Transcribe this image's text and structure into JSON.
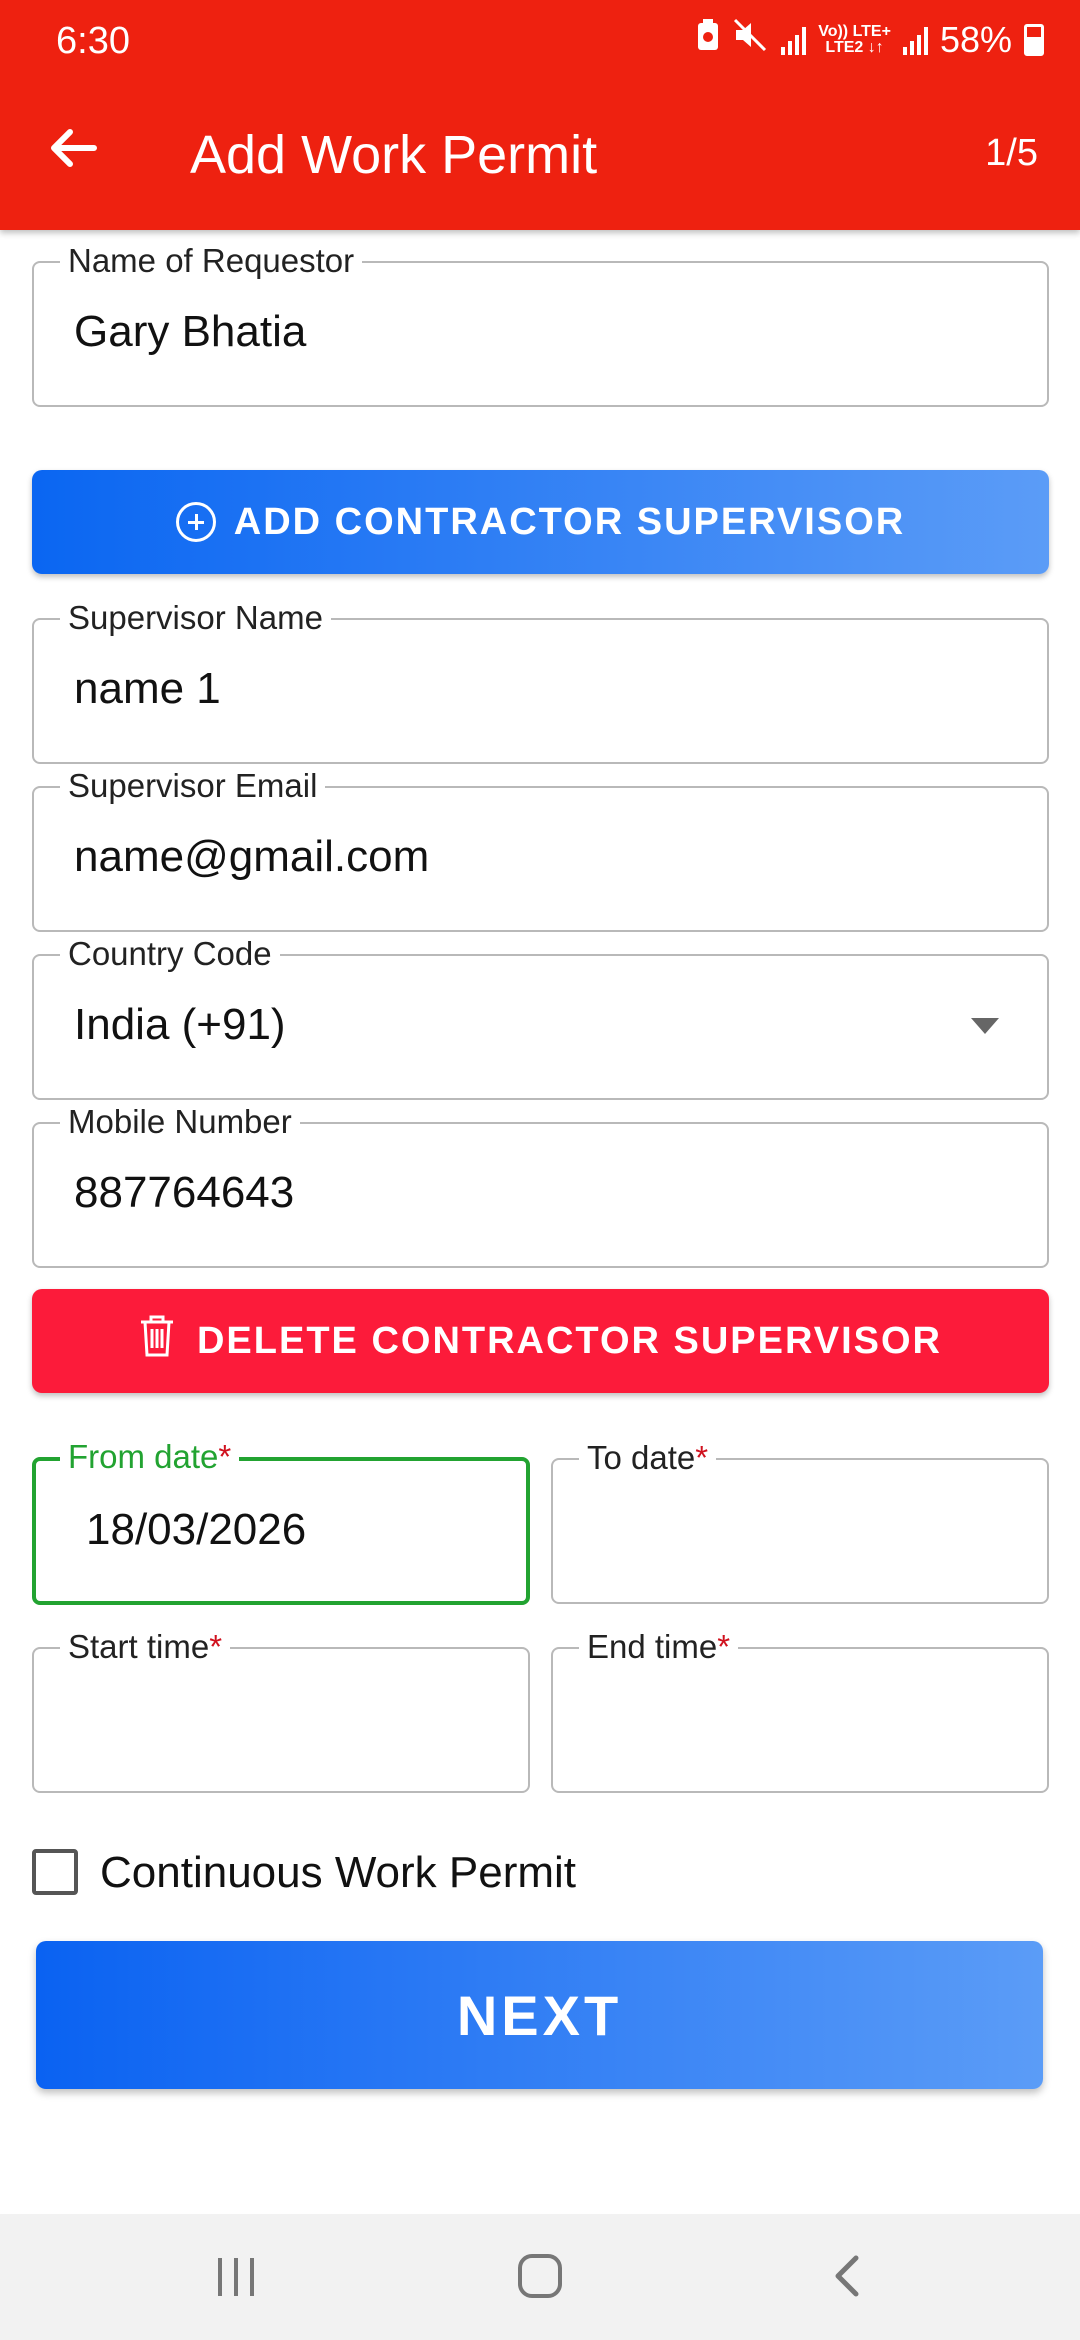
{
  "status_bar": {
    "time": "6:30",
    "network_label_top": "Vo)) LTE+",
    "network_label_bottom": "LTE2 ↓↑",
    "battery": "58%"
  },
  "app_bar": {
    "title": "Add Work Permit",
    "step": "1/5"
  },
  "form": {
    "requestor": {
      "label": "Name of Requestor",
      "value": "Gary Bhatia"
    },
    "add_supervisor_button": "ADD CONTRACTOR SUPERVISOR",
    "supervisor_name": {
      "label": "Supervisor Name",
      "value": "name 1"
    },
    "supervisor_email": {
      "label": "Supervisor Email",
      "value": "name@gmail.com"
    },
    "country_code": {
      "label": "Country Code",
      "value": "India (+91)"
    },
    "mobile_number": {
      "label": "Mobile Number",
      "value": "887764643"
    },
    "delete_supervisor_button": "DELETE CONTRACTOR SUPERVISOR",
    "from_date": {
      "label": "From date",
      "required_mark": "*",
      "value": "18/03/2026"
    },
    "to_date": {
      "label": "To date",
      "required_mark": "*",
      "value": ""
    },
    "start_time": {
      "label": "Start time",
      "required_mark": "*",
      "value": ""
    },
    "end_time": {
      "label": "End time",
      "required_mark": "*",
      "value": ""
    },
    "continuous_permit": {
      "label": "Continuous Work Permit",
      "checked": false
    },
    "next_button": "NEXT"
  },
  "colors": {
    "app_bar": "#ee2110",
    "primary_button": "#0a66f2",
    "danger_button": "#fc1b3a",
    "focus": "#22a331",
    "required": "#d0111e"
  },
  "icons": {
    "back": "arrow-left-icon",
    "add": "plus-circle-icon",
    "delete": "trash-icon",
    "dropdown": "caret-down-icon"
  }
}
